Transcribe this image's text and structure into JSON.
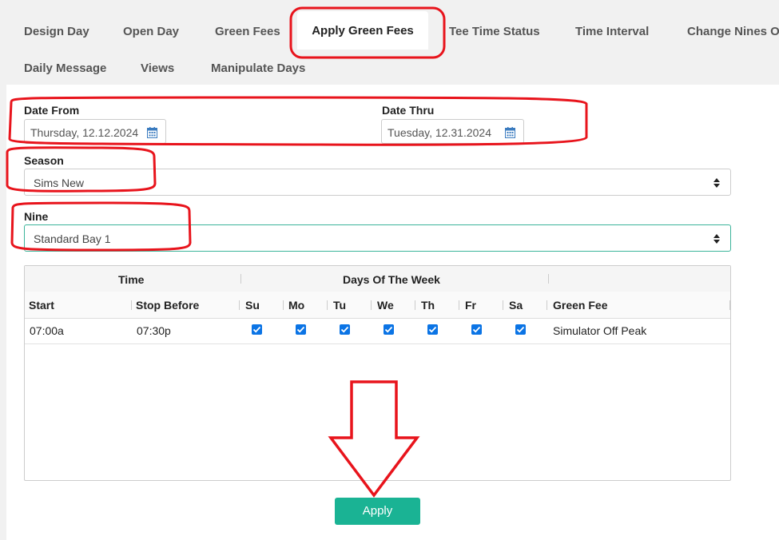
{
  "tabs": [
    {
      "label": "Design Day"
    },
    {
      "label": "Open Day"
    },
    {
      "label": "Green Fees"
    },
    {
      "label": "Apply Green Fees",
      "active": true
    },
    {
      "label": "Tee Time Status"
    },
    {
      "label": "Time Interval"
    },
    {
      "label": "Change Nines Or"
    },
    {
      "label": "Daily Message"
    },
    {
      "label": "Views"
    },
    {
      "label": "Manipulate Days"
    }
  ],
  "form": {
    "date_from_label": "Date From",
    "date_from_value": "Thursday, 12.12.2024",
    "date_thru_label": "Date Thru",
    "date_thru_value": "Tuesday, 12.31.2024",
    "season_label": "Season",
    "season_value": "Sims New",
    "nine_label": "Nine",
    "nine_value": "Standard Bay 1"
  },
  "grid": {
    "group_headers": {
      "time": "Time",
      "days": "Days Of The Week"
    },
    "columns": [
      "Start",
      "Stop Before",
      "Su",
      "Mo",
      "Tu",
      "We",
      "Th",
      "Fr",
      "Sa",
      "Green Fee"
    ],
    "rows": [
      {
        "start": "07:00a",
        "stop_before": "07:30p",
        "days": [
          true,
          true,
          true,
          true,
          true,
          true,
          true
        ],
        "green_fee": "Simulator Off Peak"
      }
    ]
  },
  "apply_label": "Apply",
  "colors": {
    "accent": "#1ab394",
    "checkbox": "#0b74e5",
    "annotation": "#e8141c",
    "focus_border": "#3bb49a"
  },
  "icons": {
    "calendar": "calendar-icon",
    "select_caret": "sort-caret-icon",
    "annotation_arrow": "down-arrow-annotation"
  }
}
